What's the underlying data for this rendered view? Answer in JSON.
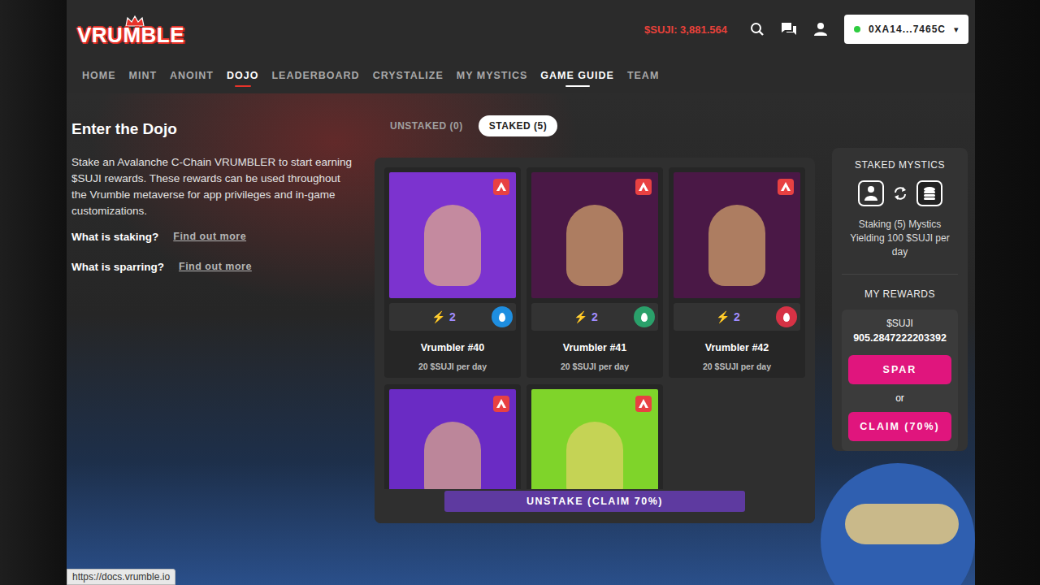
{
  "header": {
    "logo": "VRUMBLE",
    "balance": "$SUJI: 3,881.564",
    "wallet": {
      "address": "0XA14...7465C",
      "connected": true,
      "caret": "▾"
    }
  },
  "nav": [
    {
      "label": "HOME",
      "selected": false,
      "hovered": false
    },
    {
      "label": "MINT",
      "selected": false,
      "hovered": false
    },
    {
      "label": "ANOINT",
      "selected": false,
      "hovered": false
    },
    {
      "label": "DOJO",
      "selected": true,
      "hovered": false
    },
    {
      "label": "LEADERBOARD",
      "selected": false,
      "hovered": false
    },
    {
      "label": "CRYSTALIZE",
      "selected": false,
      "hovered": false
    },
    {
      "label": "MY MYSTICS",
      "selected": false,
      "hovered": false
    },
    {
      "label": "GAME GUIDE",
      "selected": false,
      "hovered": true
    },
    {
      "label": "TEAM",
      "selected": false,
      "hovered": false
    }
  ],
  "intro": {
    "title": "Enter the Dojo",
    "text": "Stake an Avalanche C-Chain VRUMBLER to start earning $SUJI rewards. These rewards can be used throughout the Vrumble metaverse for app privileges and in-game customizations.",
    "faq": [
      {
        "question": "What is staking?",
        "link": "Find out more"
      },
      {
        "question": "What is sparring?",
        "link": "Find out more"
      }
    ]
  },
  "tabs": [
    {
      "label": "UNSTAKED (0)",
      "selected": false
    },
    {
      "label": "STAKED (5)",
      "selected": true
    }
  ],
  "cards": [
    {
      "kind": "full",
      "name": "Vrumbler #40",
      "rate": "20 $SUJI per day",
      "energyIcon": "⚡",
      "energy": "2",
      "color": "#7c33cf",
      "elementColor": "#1e8ee0"
    },
    {
      "kind": "full",
      "name": "Vrumbler #41",
      "rate": "20 $SUJI per day",
      "energyIcon": "⚡",
      "energy": "2",
      "color": "#4a1846",
      "elementColor": "#2aa06a"
    },
    {
      "kind": "full",
      "name": "Vrumbler #42",
      "rate": "20 $SUJI per day",
      "energyIcon": "⚡",
      "energy": "2",
      "color": "#4a1846",
      "elementColor": "#d63245"
    },
    {
      "kind": "cut",
      "color": "#6a2bc4"
    },
    {
      "kind": "cut",
      "color": "#7fd42a"
    }
  ],
  "unstake": "UNSTAKE (CLAIM 70%)",
  "staked": {
    "title": "STAKED MYSTICS",
    "summary": "Staking (5) Mystics Yielding 100 $SUJI per day"
  },
  "rewards": {
    "title": "MY REWARDS",
    "currency": "$SUJI",
    "amount": "905.2847222203392",
    "spar": "SPAR",
    "or": "or",
    "claim": "CLAIM (70%)"
  },
  "status_bar": {
    "url": "https://docs.vrumble.io"
  }
}
